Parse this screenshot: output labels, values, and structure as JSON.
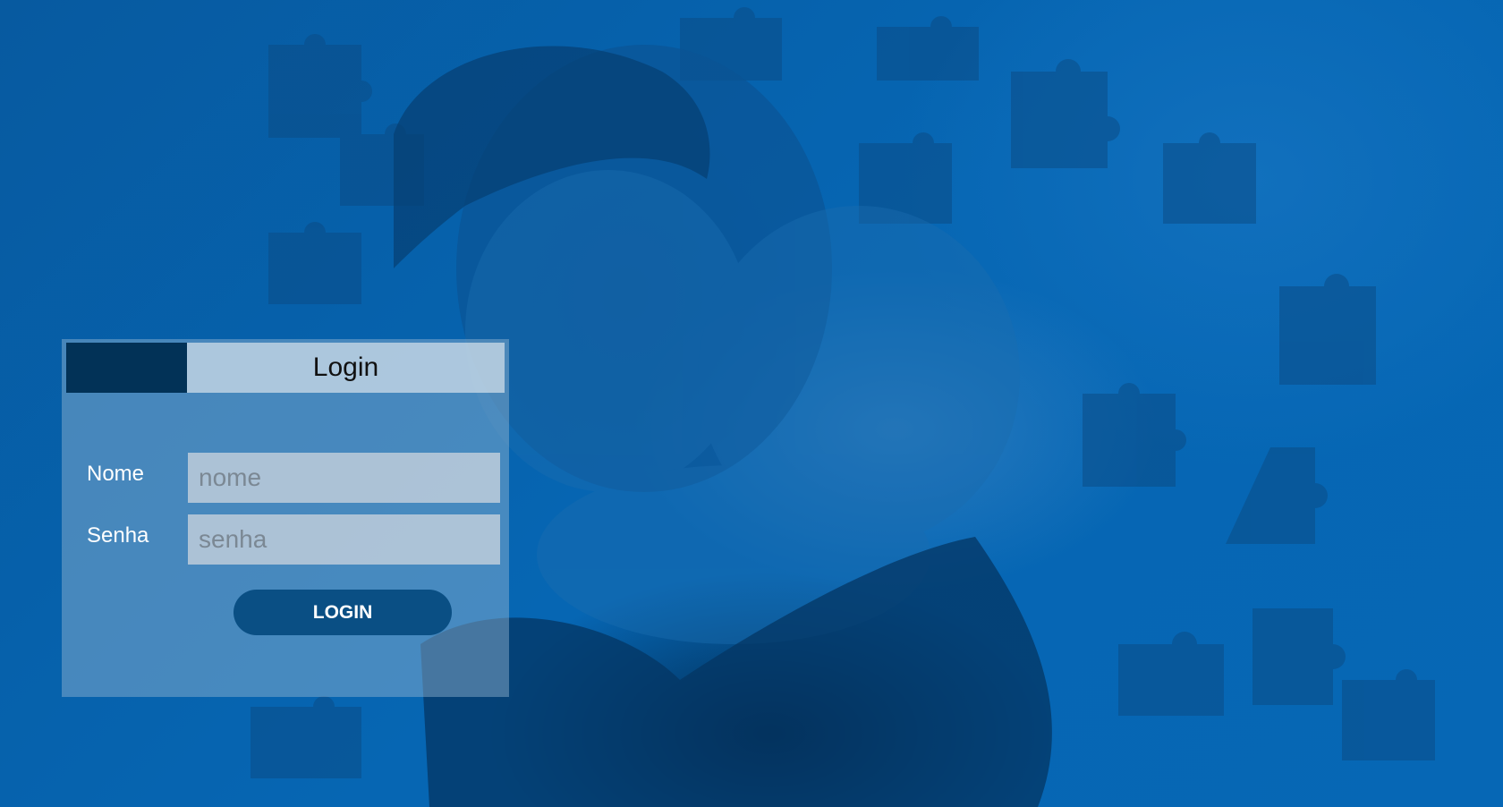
{
  "login_card": {
    "title": "Login",
    "fields": [
      {
        "label": "Nome",
        "placeholder": "nome"
      },
      {
        "label": "Senha",
        "placeholder": "senha"
      }
    ],
    "submit_label": "LOGIN"
  },
  "colors": {
    "background": "#0666b3",
    "header_accent": "#023257",
    "button": "#0a4f84"
  }
}
